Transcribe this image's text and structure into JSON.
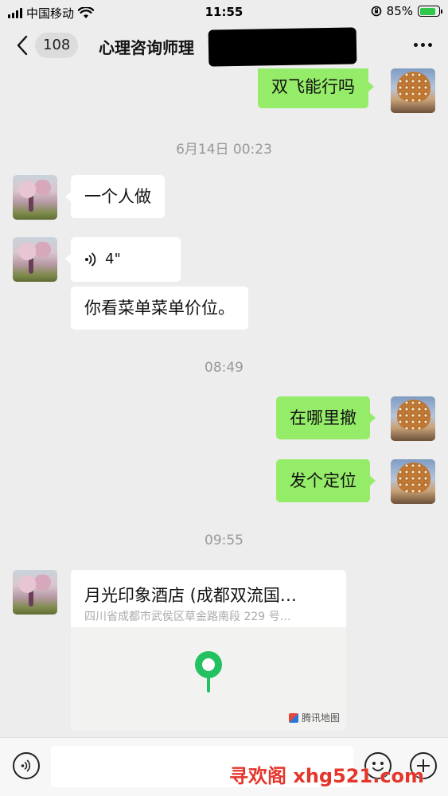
{
  "status_bar": {
    "carrier": "中国移动",
    "time": "11:55",
    "battery_percent": "85%",
    "battery_level": 0.85,
    "icons": [
      "signal-icon",
      "wifi-icon",
      "rotation-lock-icon",
      "battery-charging-icon"
    ]
  },
  "nav": {
    "back_icon": "chevron-left-icon",
    "unread_count": "108",
    "title": "心理咨询师理",
    "more_icon": "more-icon"
  },
  "messages": [
    {
      "side": "right",
      "text": "双飞能行吗"
    },
    {
      "type": "time",
      "text": "6月14日 00:23"
    },
    {
      "side": "left",
      "text": "一个人做"
    },
    {
      "side": "left",
      "type": "voice",
      "duration": "4\""
    },
    {
      "side": "left",
      "text": "你看菜单菜单价位。"
    },
    {
      "type": "time",
      "text": "08:49"
    },
    {
      "side": "right",
      "text": "在哪里撤"
    },
    {
      "side": "right",
      "text": "发个定位"
    },
    {
      "type": "time",
      "text": "09:55"
    }
  ],
  "location": {
    "name": "月光印象酒店 (成都双流国…",
    "address": "四川省成都市武侯区草金路南段 229 号…",
    "map_attribution": "腾讯地图"
  },
  "input_bar": {
    "voice_icon": "voice-icon",
    "emoji_icon": "emoji-icon",
    "plus_icon": "plus-icon",
    "watermark": "寻欢阁 xhg521.com"
  },
  "colors": {
    "background": "#ededed",
    "sent_bubble": "#95ec69",
    "received_bubble": "#ffffff",
    "timestamp": "#999999",
    "map_pin": "#23c15f",
    "watermark": "#e5352b"
  }
}
